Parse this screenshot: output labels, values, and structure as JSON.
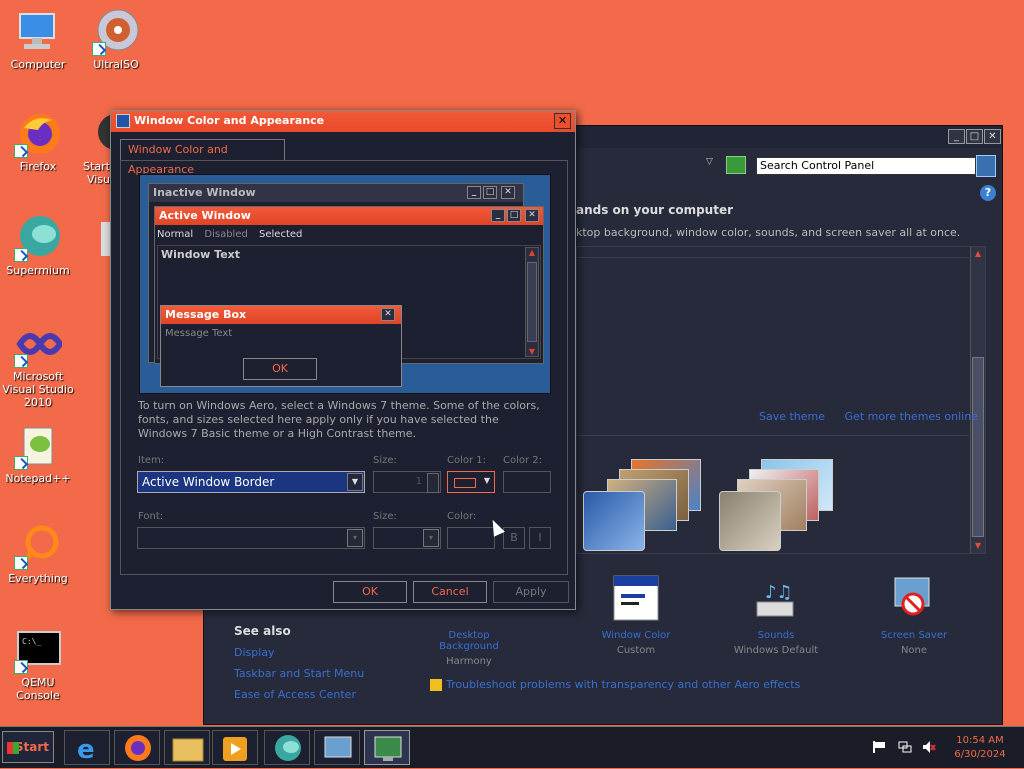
{
  "desktop": {
    "icons": [
      {
        "label": "Computer"
      },
      {
        "label": "UltraISO"
      },
      {
        "label": "Firefox"
      },
      {
        "label": "Start Visu"
      },
      {
        "label": "Supermium"
      },
      {
        "label": "Microsoft Visual Studio 2010"
      },
      {
        "label": "Notepad++"
      },
      {
        "label": "Everything"
      },
      {
        "label": "QEMU Console"
      }
    ]
  },
  "control_panel": {
    "search_placeholder": "Search Control Panel",
    "heading": "ands on your computer",
    "subtext": "ktop background, window color, sounds, and screen saver all at once.",
    "links": [
      "Save theme",
      "Get more themes online"
    ],
    "bottom_items": [
      {
        "title": "Desktop Background",
        "sub": "Harmony"
      },
      {
        "title": "Window Color",
        "sub": "Custom"
      },
      {
        "title": "Sounds",
        "sub": "Windows Default"
      },
      {
        "title": "Screen Saver",
        "sub": "None"
      }
    ],
    "see_also": "See also",
    "see_also_links": [
      "Display",
      "Taskbar and Start Menu",
      "Ease of Access Center"
    ],
    "troubleshoot": "Troubleshoot problems with transparency and other Aero effects"
  },
  "dialog": {
    "title": "Window Color and Appearance",
    "tab": "Window Color and Appearance",
    "preview": {
      "inactive_title": "Inactive Window",
      "active_title": "Active Window",
      "menu": [
        "Normal",
        "Disabled",
        "Selected"
      ],
      "window_text": "Window Text",
      "msgbox_title": "Message Box",
      "msgbox_text": "Message Text",
      "msgbox_ok": "OK"
    },
    "description": "To turn on Windows Aero, select a Windows 7 theme. Some of the colors, fonts, and sizes selected here apply only if you have selected the Windows 7 Basic theme or a High Contrast theme.",
    "item_label": "Item:",
    "item_value": "Active Window Border",
    "size_label": "Size:",
    "size_value": "1",
    "color1_label": "Color 1:",
    "color2_label": "Color 2:",
    "font_label": "Font:",
    "font_size_label": "Size:",
    "font_color_label": "Color:",
    "bold": "B",
    "italic": "I",
    "ok": "OK",
    "cancel": "Cancel",
    "apply": "Apply",
    "colors": {
      "accent": "#f26a4a",
      "selection": "#1c3580"
    }
  },
  "taskbar": {
    "start": "Start",
    "time": "10:54 AM",
    "date": "6/30/2024"
  }
}
